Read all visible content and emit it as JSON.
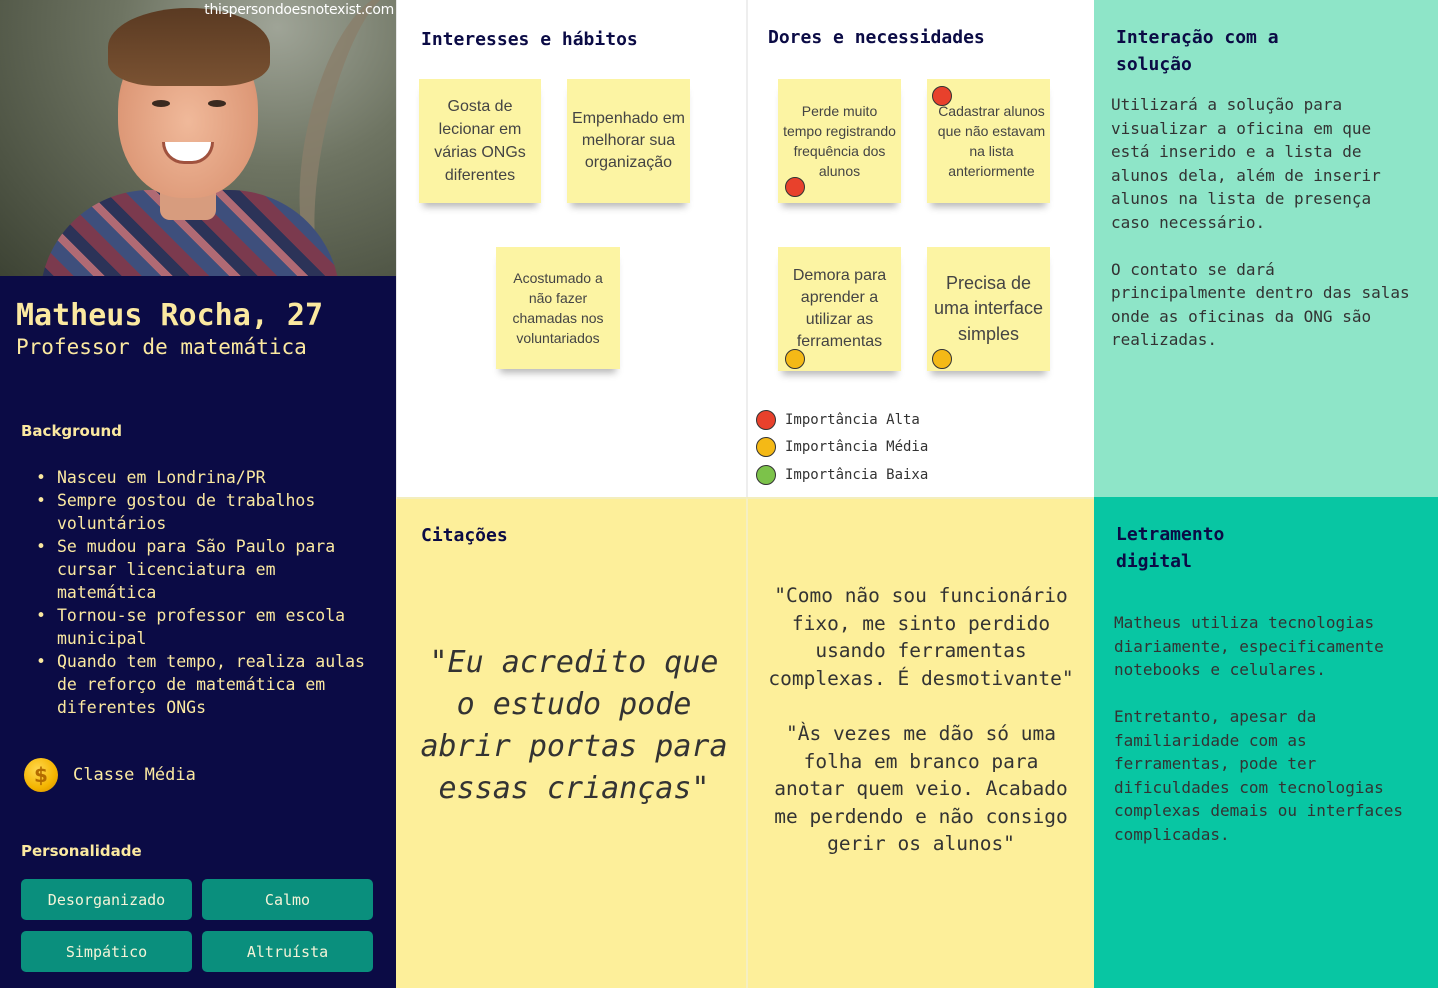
{
  "persona": {
    "watermark": "thispersondoesnotexist.com",
    "name": "Matheus Rocha, 27",
    "role": "Professor de matemática",
    "background_title": "Background",
    "background_items": [
      "Nasceu em Londrina/PR",
      "Sempre gostou de trabalhos voluntários",
      "Se mudou para São Paulo para cursar licenciatura em matemática",
      "Tornou-se professor em escola municipal",
      "Quando tem tempo, realiza aulas de reforço de matemática em diferentes ONGs"
    ],
    "class_icon": "coin-icon",
    "class_label": "Classe Média",
    "personality_title": "Personalidade",
    "personality_tags": [
      "Desorganizado",
      "Calmo",
      "Simpático",
      "Altruísta"
    ]
  },
  "interests": {
    "title": "Interesses e hábitos",
    "notes": [
      "Gosta de lecionar em várias ONGs diferentes",
      "Empenhado em melhorar sua organização",
      "Acostumado a não fazer chamadas nos voluntariados"
    ]
  },
  "pains": {
    "title": "Dores e necessidades",
    "notes": [
      {
        "text": "Perde muito tempo registrando frequência dos alunos",
        "importance": "Alta"
      },
      {
        "text": "Cadastrar alunos que não estavam na lista anteriormente",
        "importance": "Alta"
      },
      {
        "text": "Demora para aprender a utilizar as ferramentas",
        "importance": "Média"
      },
      {
        "text": "Precisa de uma interface simples",
        "importance": "Média"
      }
    ],
    "legend": [
      "Importância Alta",
      "Importância Média",
      "Importância Baixa"
    ],
    "legend_colors": [
      "#e8412c",
      "#f4b916",
      "#7cc24a"
    ]
  },
  "interaction": {
    "title": "Interação com a solução",
    "text": "Utilizará a solução para visualizar a oficina em que está inserido e a lista de alunos dela, além de inserir alunos na lista de presença caso necessário.\n\nO contato se dará principalmente dentro das salas onde as oficinas da ONG são realizadas."
  },
  "quotes": {
    "title": "Citações",
    "main": "\"Eu acredito que o estudo pode abrir portas para essas crianças\"",
    "side": "\"Como não sou funcionário fixo, me sinto perdido usando ferramentas complexas. É desmotivante\"\n\n\"Às vezes me dão só uma folha em branco para anotar quem veio. Acabado me perdendo e não consigo gerir os alunos\""
  },
  "literacy": {
    "title": "Letramento digital",
    "text": "Matheus utiliza tecnologias diariamente, especificamente notebooks e celulares.\n\nEntretanto, apesar da familiaridade com as ferramentas, pode ter dificuldades com tecnologias complexas demais ou interfaces complicadas."
  },
  "colors": {
    "persona_bg": "#0b0b45",
    "persona_text": "#fbe9a0",
    "tag_bg": "#0a8f7d",
    "interaction_bg": "#8ee5c8",
    "literacy_bg": "#08c6a3",
    "quotes_bg": "#fdef9a",
    "sticky_bg": "#fcf4a3"
  }
}
